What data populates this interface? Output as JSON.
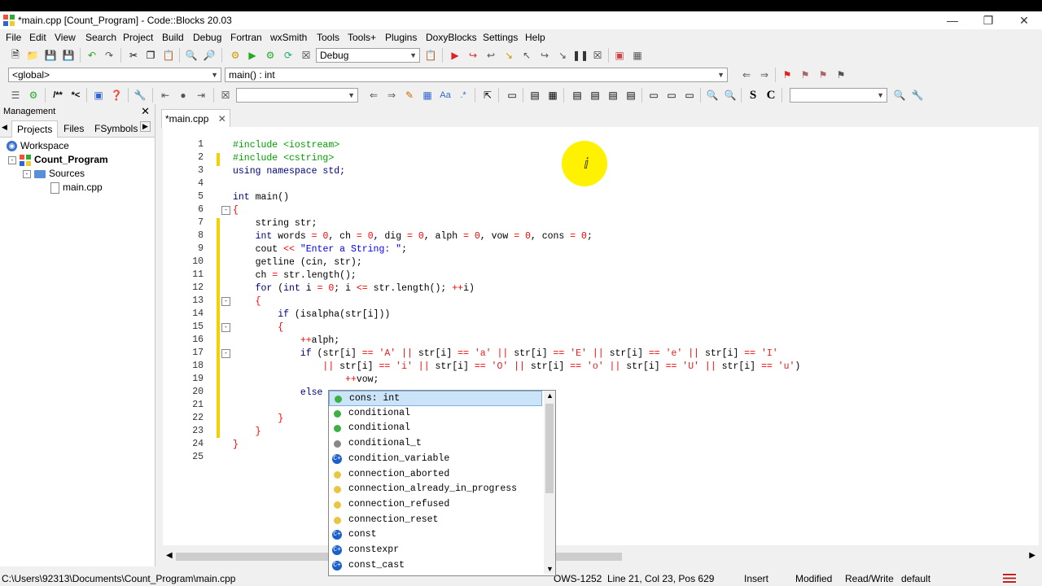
{
  "window": {
    "title": "*main.cpp [Count_Program] - Code::Blocks 20.03"
  },
  "menu": [
    "File",
    "Edit",
    "View",
    "Search",
    "Project",
    "Build",
    "Debug",
    "Fortran",
    "wxSmith",
    "Tools",
    "Tools+",
    "Plugins",
    "DoxyBlocks",
    "Settings",
    "Help"
  ],
  "toolbar": {
    "build_target": "Debug",
    "scope": "<global>",
    "function": "main() : int",
    "search_placeholder": "",
    "search2": ""
  },
  "management": {
    "title": "Management",
    "tabs": [
      "Projects",
      "Files",
      "FSymbols"
    ],
    "tree": {
      "workspace": "Workspace",
      "project": "Count_Program",
      "folder": "Sources",
      "file": "main.cpp"
    }
  },
  "editor": {
    "tab": "*main.cpp",
    "line_numbers": [
      "1",
      "2",
      "3",
      "4",
      "5",
      "6",
      "7",
      "8",
      "9",
      "10",
      "11",
      "12",
      "13",
      "14",
      "15",
      "16",
      "17",
      "18",
      "19",
      "20",
      "21",
      "22",
      "23",
      "24",
      "25"
    ]
  },
  "autocomplete": {
    "items": [
      {
        "label": "cons: int",
        "icon": "variable-icon",
        "selected": true
      },
      {
        "label": "conditional",
        "icon": "class-icon"
      },
      {
        "label": "conditional",
        "icon": "class-icon"
      },
      {
        "label": "conditional_t",
        "icon": "typedef-icon"
      },
      {
        "label": "condition_variable",
        "icon": "cpp-class-icon"
      },
      {
        "label": "connection_aborted",
        "icon": "enum-value-icon"
      },
      {
        "label": "connection_already_in_progress",
        "icon": "enum-value-icon"
      },
      {
        "label": "connection_refused",
        "icon": "enum-value-icon"
      },
      {
        "label": "connection_reset",
        "icon": "enum-value-icon"
      },
      {
        "label": "const",
        "icon": "cpp-keyword-icon"
      },
      {
        "label": "constexpr",
        "icon": "cpp-keyword-icon"
      },
      {
        "label": "const_cast",
        "icon": "cpp-keyword-icon"
      }
    ]
  },
  "status": {
    "path": "C:\\Users\\92313\\Documents\\Count_Program\\main.cpp",
    "encoding": "OWS-1252",
    "position": "Line 21, Col 23, Pos 629",
    "mode": "Insert",
    "modified": "Modified",
    "access": "Read/Write",
    "profile": "default"
  }
}
